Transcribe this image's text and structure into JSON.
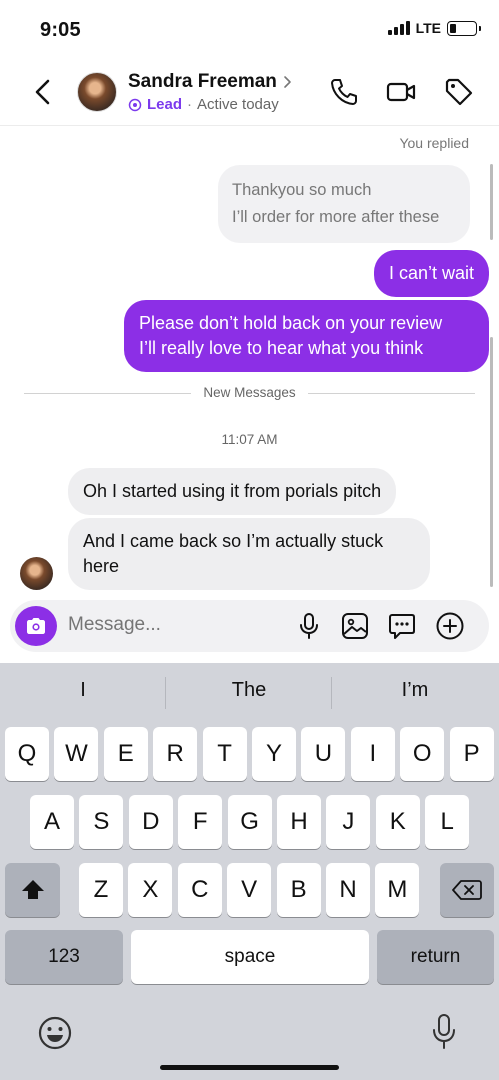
{
  "status_bar": {
    "time": "9:05",
    "network": "LTE",
    "battery_level": 0.25
  },
  "header": {
    "contact_name": "Sandra Freeman",
    "label": "Lead",
    "separator": "·",
    "presence": "Active today"
  },
  "chat": {
    "replied_label": "You replied",
    "reply_quote": {
      "line1": "Thankyou so much",
      "line2": "I’ll order for more after these"
    },
    "outgoing": [
      {
        "text": "I can’t wait"
      },
      {
        "line1": "Please don’t hold back on your review",
        "line2": "I’ll really love to hear what you think"
      }
    ],
    "new_messages_label": "New Messages",
    "timestamp": "11:07 AM",
    "incoming": [
      {
        "text": "Oh I started using it from porials pitch"
      },
      {
        "line1": "And I came back so I’m actually stuck",
        "line2": "here"
      }
    ]
  },
  "composer": {
    "placeholder": "Message..."
  },
  "keyboard": {
    "suggestions": [
      "I",
      "The",
      "I’m"
    ],
    "row1": [
      "Q",
      "W",
      "E",
      "R",
      "T",
      "Y",
      "U",
      "I",
      "O",
      "P"
    ],
    "row2": [
      "A",
      "S",
      "D",
      "F",
      "G",
      "H",
      "J",
      "K",
      "L"
    ],
    "row3": [
      "Z",
      "X",
      "C",
      "V",
      "B",
      "N",
      "M"
    ],
    "numbers_key": "123",
    "space_key": "space",
    "return_key": "return"
  },
  "colors": {
    "accent": "#8c2fe6",
    "lead": "#7c3aed",
    "keyboard_bg": "#d2d4da"
  }
}
